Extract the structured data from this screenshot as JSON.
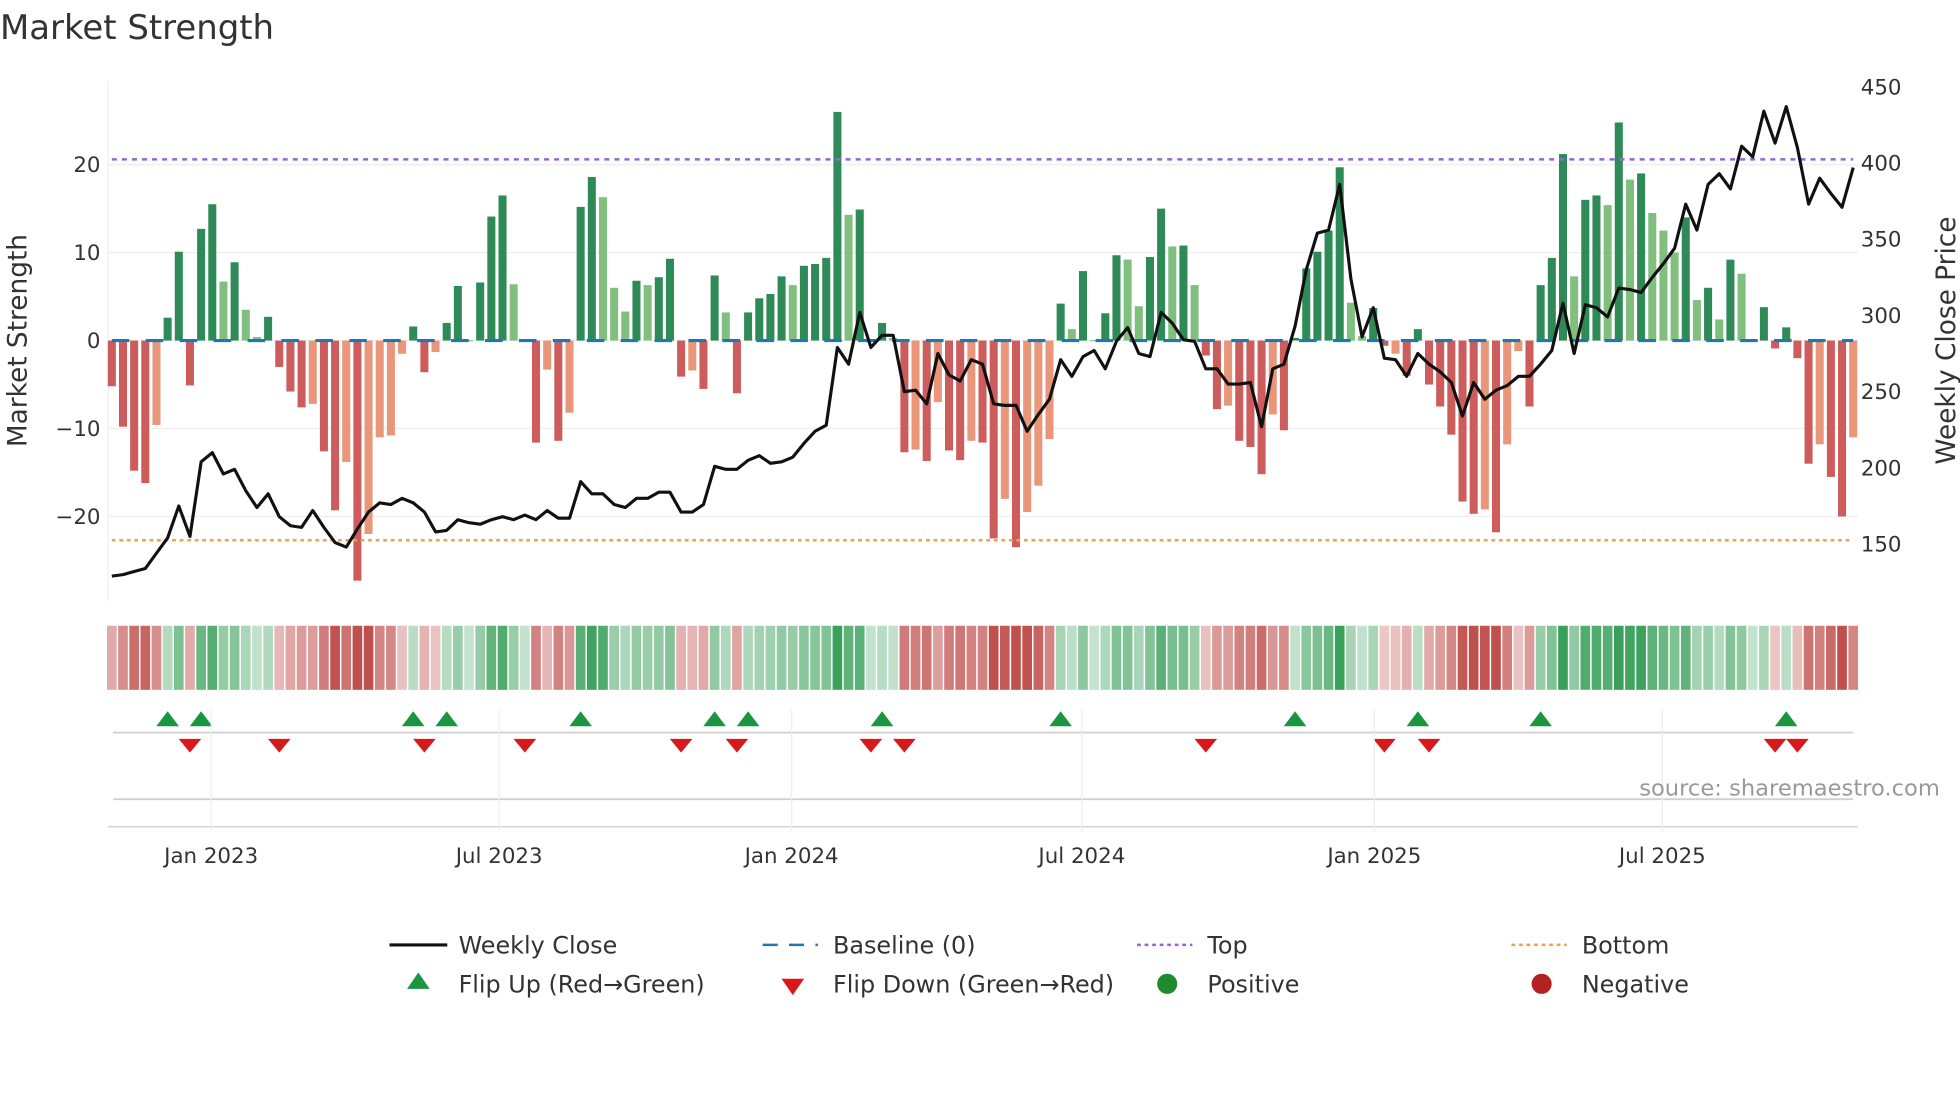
{
  "chart_data": {
    "type": "bar",
    "title": "Market Strength",
    "ylabel": "Market Strength",
    "y2label": "Weekly Close Price",
    "ylim": [
      -29,
      29
    ],
    "y2lim": [
      110,
      455
    ],
    "yticks": [
      20,
      10,
      0,
      -10,
      -20
    ],
    "yticklabels": [
      "20",
      "10",
      "0",
      "−10",
      "−20"
    ],
    "y2ticks": [
      450,
      400,
      350,
      300,
      250,
      200,
      150
    ],
    "y2ticklabels": [
      "450",
      "400",
      "350",
      "300",
      "250",
      "200",
      "150"
    ],
    "x_unit": "week index (0 = first weekly bar, ~end Oct 2022)",
    "xticks": [
      8.9,
      34.7,
      60.9,
      86.9,
      113.1,
      138.9
    ],
    "xticklabels": [
      "Jan 2023",
      "Jul 2023",
      "Jan 2024",
      "Jul 2024",
      "Jan 2025",
      "Jul 2025"
    ],
    "top_level": 20.6,
    "bottom_level": -22.7,
    "baseline": 0,
    "strength": [
      -5.2,
      -9.8,
      -14.8,
      -16.2,
      -9.6,
      2.6,
      10.1,
      -5.1,
      12.7,
      15.5,
      6.7,
      8.9,
      3.5,
      0.4,
      2.7,
      -3,
      -5.8,
      -7.6,
      -7.2,
      -12.6,
      -19.3,
      -13.8,
      -27.3,
      -22,
      -11,
      -10.8,
      -1.5,
      1.6,
      -3.6,
      -1.3,
      2.0,
      6.2,
      0,
      6.6,
      14.1,
      16.5,
      6.4,
      0,
      -11.6,
      -3.3,
      -11.4,
      -8.2,
      15.2,
      18.6,
      16.3,
      6.0,
      3.3,
      6.8,
      6.3,
      7.2,
      9.3,
      -4.1,
      -3.4,
      -5.5,
      7.4,
      3.2,
      -6.0,
      3.2,
      4.8,
      5.3,
      7.3,
      6.3,
      8.5,
      8.7,
      9.4,
      26,
      14.3,
      14.9,
      0,
      2,
      0.3,
      -12.7,
      -12.4,
      -13.7,
      -7,
      -12.5,
      -13.6,
      -11.4,
      -11.6,
      -22.5,
      -18,
      -23.5,
      -19.5,
      -16.5,
      -11.2,
      4.2,
      1.3,
      7.9,
      0,
      3.1,
      9.7,
      9.2,
      3.9,
      9.5,
      15,
      10.7,
      10.8,
      6.3,
      -1.7,
      -7.8,
      -7.4,
      -11.4,
      -12.1,
      -15.2,
      -8.4,
      -10.2,
      0.3,
      8.2,
      10.1,
      12.5,
      19.7,
      4.3,
      0.5,
      3.7,
      -0.6,
      -1.5,
      -4,
      1.3,
      -5,
      -7.5,
      -10.7,
      -18.3,
      -19.7,
      -19.2,
      -21.8,
      -11.8,
      -1.2,
      -7.5,
      6.3,
      9.4,
      21.2,
      7.3,
      16,
      16.5,
      15.4,
      24.8,
      18.3,
      19.0,
      14.5,
      12.5,
      10.0,
      14.0,
      4.6,
      6.0,
      2.4,
      9.2,
      7.6,
      0,
      3.8,
      -0.9,
      1.5,
      -2,
      -14,
      -11.8,
      -15.5,
      -20,
      -11
    ],
    "strength_weakening": [
      0,
      0,
      0,
      0,
      1,
      0,
      0,
      0,
      0,
      0,
      1,
      0,
      1,
      1,
      0,
      0,
      0,
      0,
      1,
      0,
      0,
      1,
      0,
      1,
      1,
      1,
      1,
      0,
      0,
      1,
      0,
      0,
      0,
      0,
      0,
      0,
      1,
      0,
      0,
      1,
      0,
      1,
      0,
      0,
      1,
      1,
      1,
      0,
      1,
      0,
      0,
      0,
      1,
      0,
      0,
      1,
      0,
      0,
      0,
      0,
      0,
      1,
      0,
      0,
      0,
      0,
      1,
      0,
      0,
      0,
      1,
      0,
      1,
      0,
      1,
      0,
      0,
      1,
      0,
      0,
      1,
      0,
      1,
      1,
      1,
      0,
      1,
      0,
      0,
      0,
      0,
      1,
      1,
      0,
      0,
      1,
      0,
      1,
      0,
      0,
      1,
      0,
      0,
      0,
      1,
      0,
      0,
      0,
      0,
      0,
      0,
      1,
      1,
      0,
      0,
      1,
      0,
      0,
      0,
      0,
      0,
      0,
      0,
      1,
      0,
      1,
      1,
      0,
      0,
      0,
      0,
      1,
      0,
      0,
      1,
      0,
      1,
      0,
      1,
      1,
      1,
      0,
      1,
      0,
      1,
      0,
      1,
      0,
      0,
      0,
      0,
      0,
      0,
      1,
      0,
      0,
      1
    ],
    "weekly_close": [
      129,
      130,
      132,
      134,
      144,
      154,
      175,
      155,
      204,
      210,
      196,
      199,
      185,
      174,
      183,
      168,
      162,
      161,
      172,
      161,
      151,
      148,
      160,
      171,
      177,
      176,
      180,
      177,
      171,
      158,
      159,
      166,
      164,
      163,
      166,
      168,
      166,
      169,
      166,
      172,
      167,
      167,
      191,
      183,
      183,
      176,
      174,
      180,
      180,
      184,
      184,
      171,
      171,
      176,
      201,
      199,
      199,
      205,
      208,
      203,
      204,
      207,
      216,
      224,
      228,
      279,
      268,
      302,
      279,
      287,
      287,
      250,
      251,
      242,
      275,
      261,
      257,
      271,
      268,
      242,
      241,
      241,
      224,
      235,
      245,
      271,
      260,
      273,
      277,
      265,
      283,
      292,
      275,
      273,
      302,
      295,
      284,
      283,
      265,
      265,
      255,
      255,
      256,
      227,
      265,
      268,
      293,
      330,
      354,
      356,
      386,
      324,
      286,
      305,
      272,
      271,
      260,
      275,
      268,
      263,
      256,
      234,
      256,
      245,
      251,
      254,
      260,
      260,
      268,
      277,
      308,
      275,
      307,
      305,
      299,
      318,
      317,
      315,
      325,
      334,
      344,
      373,
      356,
      386,
      393,
      383,
      411,
      404,
      434,
      413,
      437,
      410,
      373,
      390,
      380,
      371,
      397
    ],
    "flip_up_weeks": [
      5,
      8,
      27,
      30,
      42,
      54,
      57,
      69,
      85,
      106,
      117,
      128,
      150
    ],
    "flip_down_weeks": [
      7,
      15,
      28,
      37,
      51,
      56,
      68,
      71,
      98,
      114,
      118,
      149,
      151
    ],
    "legend": {
      "weekly_close": "Weekly Close",
      "baseline": "Baseline (0)",
      "top": "Top",
      "bottom": "Bottom",
      "flip_up": "Flip Up (Red→Green)",
      "flip_down": "Flip Down (Green→Red)",
      "positive": "Positive",
      "negative": "Negative"
    },
    "legend_placement": "bottom-center",
    "source": "source: sharemaestro.com",
    "colors": {
      "pos_strong": "#2e8b57",
      "pos_weak": "#80bf7e",
      "neg_strong": "#cd5c5c",
      "neg_weak": "#e9967a",
      "price": "#111111",
      "baseline": "#1f77b4",
      "top": "#9467d6",
      "bottom": "#f0a050",
      "flip_up": "#1a9641",
      "flip_down": "#d7191c",
      "positive_dot": "#1e8c2e",
      "negative_dot": "#b22222"
    }
  }
}
